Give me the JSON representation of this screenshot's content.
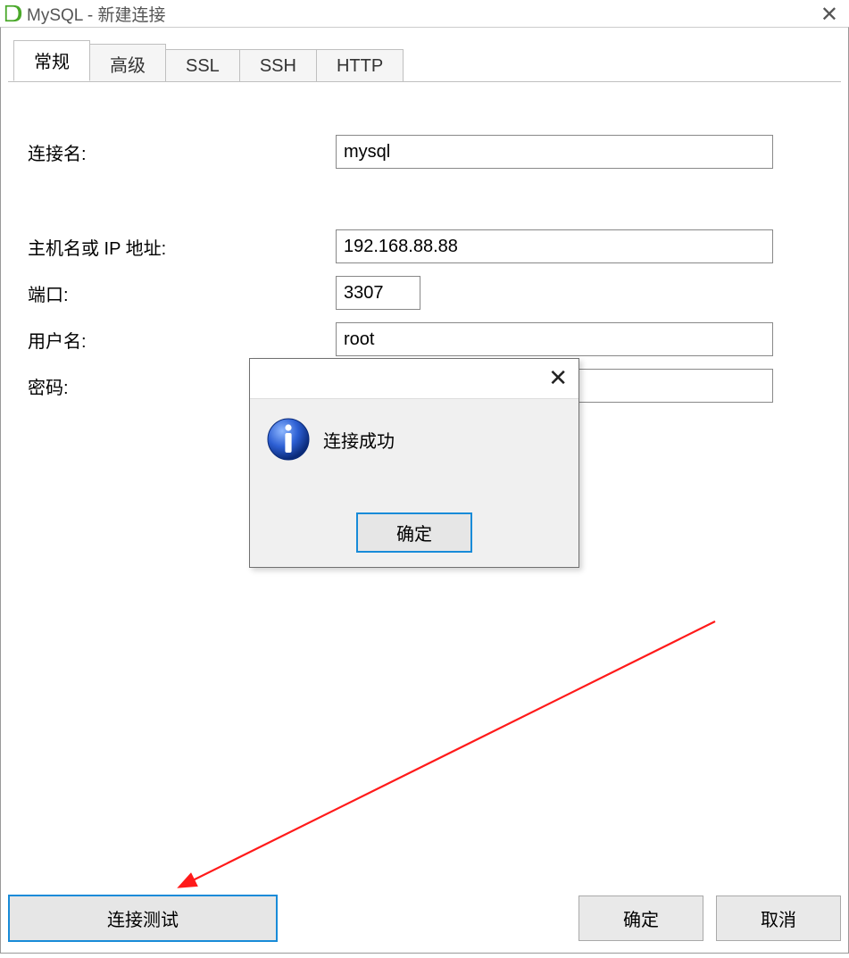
{
  "window": {
    "title": "MySQL - 新建连接"
  },
  "tabs": {
    "general": "常规",
    "advanced": "高级",
    "ssl": "SSL",
    "ssh": "SSH",
    "http": "HTTP"
  },
  "form": {
    "labels": {
      "connection_name": "连接名:",
      "host": "主机名或 IP 地址:",
      "port": "端口:",
      "username": "用户名:",
      "password": "密码:"
    },
    "values": {
      "connection_name": "mysql",
      "host": "192.168.88.88",
      "port": "3307",
      "username": "root",
      "password": "••••••••••"
    }
  },
  "buttons": {
    "test_connection": "连接测试",
    "ok": "确定",
    "cancel": "取消"
  },
  "popup": {
    "message": "连接成功",
    "ok": "确定"
  }
}
